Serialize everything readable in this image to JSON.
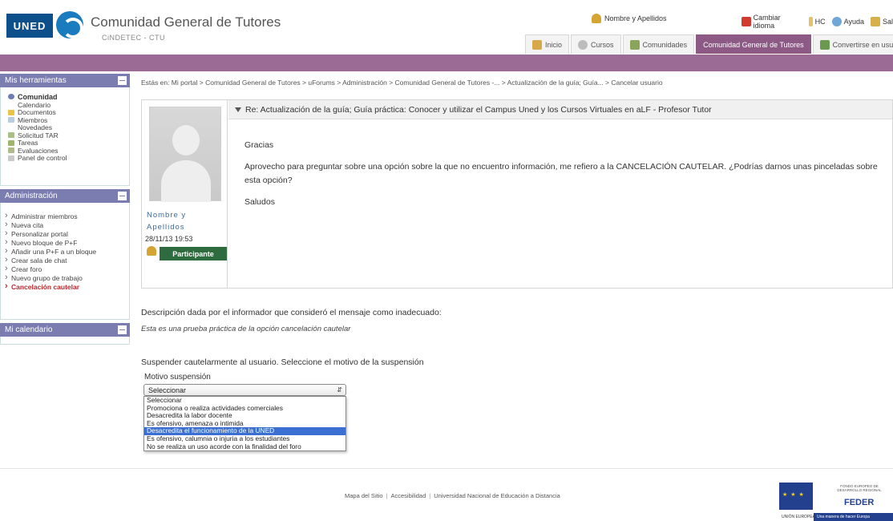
{
  "header": {
    "logo_text": "UNED",
    "title": "Comunidad General de Tutores",
    "subtitle": "CiNDETEC - CTU",
    "user_name": "Nombre y Apellidos",
    "top_links": [
      "Cambiar idioma",
      "HC",
      "Ayuda",
      "Sal"
    ],
    "nav": [
      "Inicio",
      "Cursos",
      "Comunidades",
      "Comunidad General de Tutores",
      "Convertirse en usua"
    ]
  },
  "sidebar": {
    "tools_title": "Mis herramientas",
    "tools": [
      {
        "label": "Comunidad",
        "icon": "community-icon",
        "color": "#6f7bb5"
      },
      {
        "label": "Calendario",
        "icon": "calendar-icon",
        "color": "#c9d6ea"
      },
      {
        "label": "Documentos",
        "icon": "folder-icon",
        "color": "#e8c44a"
      },
      {
        "label": "Miembros",
        "icon": "members-icon",
        "color": "#b8cde0"
      },
      {
        "label": "Novedades",
        "icon": "news-icon",
        "color": "#dde6f0"
      },
      {
        "label": "Solicitud TAR",
        "icon": "request-icon",
        "color": "#a7c083"
      },
      {
        "label": "Tareas",
        "icon": "tasks-icon",
        "color": "#9fb56b"
      },
      {
        "label": "Evaluaciones",
        "icon": "evaluations-icon",
        "color": "#b0b98a"
      },
      {
        "label": "Panel de control",
        "icon": "control-panel-icon",
        "color": "#c9c9c9"
      }
    ],
    "admin_title": "Administración",
    "admin_items": [
      "Administrar miembros",
      "Nueva cita",
      "Personalizar portal",
      "Nuevo bloque de P+F",
      "Añadir una P+F a un bloque",
      "Crear sala de chat",
      "Crear foro",
      "Nuevo grupo de trabajo",
      "Cancelación cautelar"
    ],
    "calendar_title": "Mi calendario"
  },
  "breadcrumb": "Estás en: Mi portal > Comunidad General de Tutores > uForums > Administración > Comunidad General de Tutores -... > Actualización de la guía; Guía... > Cancelar usuario",
  "post": {
    "author_name": "Nombre y Apellidos",
    "date": "28/11/13 19:53",
    "role": "Participante",
    "subject": "Re: Actualización de la guía; Guía práctica: Conocer y utilizar el Campus Uned y los Cursos Virtuales en aLF - Profesor Tutor",
    "body": [
      "Gracias",
      "Aprovecho para preguntar sobre una opción sobre la que no encuentro información, me refiero a la CANCELACIÓN CAUTELAR. ¿Podrías darnos unas pinceladas sobre esta opción?",
      "Saludos"
    ]
  },
  "report": {
    "label": "Descripción dada por el informador que consideró el mensaje como inadecuado:",
    "text": "Esta es una prueba práctica de la opción cancelación cautelar"
  },
  "suspension": {
    "label": "Suspender cautelarmente al usuario. Seleccione el motivo de la suspensión",
    "field_label": "Motivo suspensión",
    "selected": "Seleccionar",
    "options": [
      "Seleccionar",
      "Promociona o realiza actividades comerciales",
      "Desacredita la labor docente",
      "Es ofensivo, amenaza o intimida",
      "Desacredita el funcionamiento de la UNED",
      "Es ofensivo, calumnia o injuria a los estudiantes",
      "No se realiza un uso acorde con la finalidad del foro"
    ],
    "highlighted_index": 4
  },
  "footer": {
    "links": [
      "Mapa del Sitio",
      "Accesibilidad",
      "Universidad Nacional de Educación a Distancia"
    ],
    "feder_small": "FONDO EUROPEO DE DESARROLLO REGIONAL",
    "feder_big": "FEDER",
    "eu_label": "UNIÓN EUROPEA",
    "slogan": "Una manera de hacer Europa"
  },
  "colors": {
    "accent_purple": "#9b6b95",
    "sidebar_header": "#7b7db0",
    "role_badge": "#2e6b3f",
    "highlight_red": "#c0242a",
    "selected_option": "#3b6fd1"
  }
}
